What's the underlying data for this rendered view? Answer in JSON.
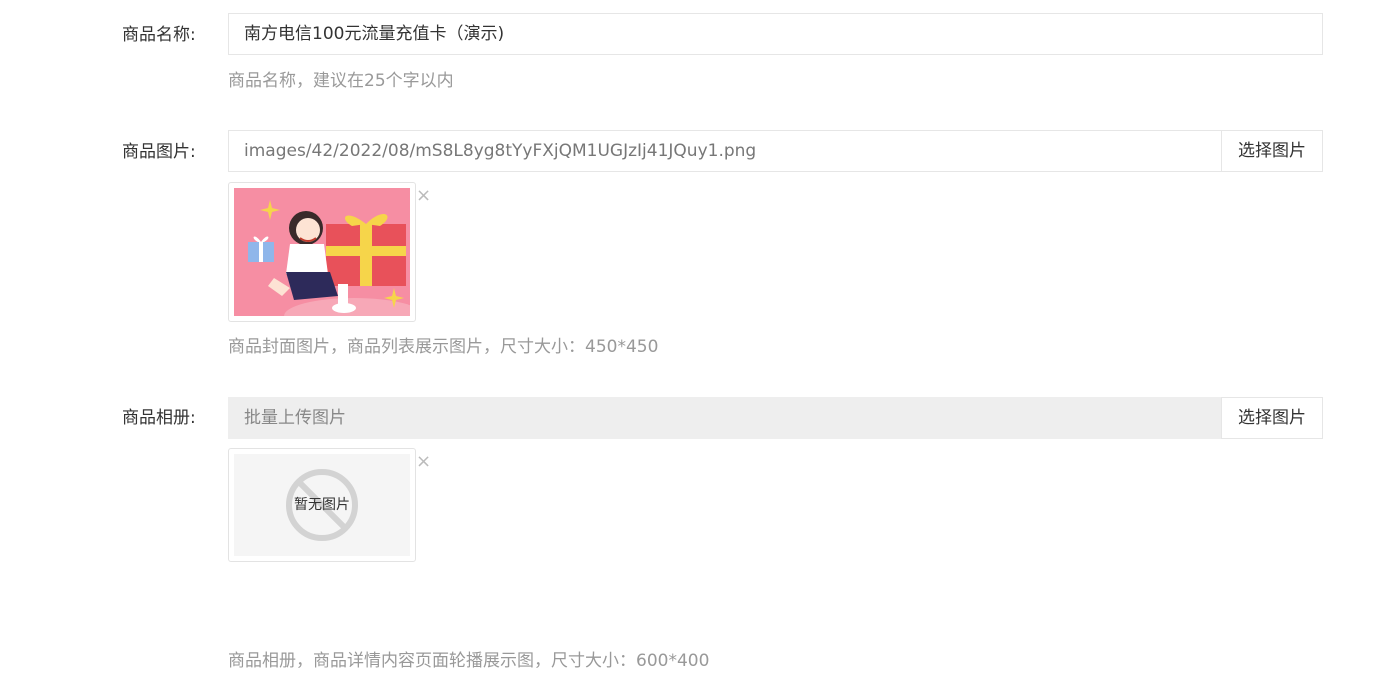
{
  "name_field": {
    "label": "商品名称:",
    "value": "南方电信100元流量充值卡（演示)",
    "help": "商品名称，建议在25个字以内"
  },
  "image_field": {
    "label": "商品图片:",
    "value": "images/42/2022/08/mS8L8yg8tYyFXjQM1UGJzIj41JQuy1.png",
    "button": "选择图片",
    "remove": "×",
    "help": "商品封面图片，商品列表展示图片，尺寸大小：450*450"
  },
  "album_field": {
    "label": "商品相册:",
    "placeholder": "批量上传图片",
    "button": "选择图片",
    "remove": "×",
    "no_image_text": "暂无图片",
    "help": "商品相册，商品详情内容页面轮播展示图，尺寸大小：600*400"
  },
  "colors": {
    "pink_bg": "#f68ea3",
    "gift_red": "#e8515a",
    "gift_yellow": "#f6d54a",
    "gift_blue": "#8fb6ea"
  },
  "icons": [
    "close-icon",
    "no-image-icon",
    "sparkle-icon"
  ]
}
